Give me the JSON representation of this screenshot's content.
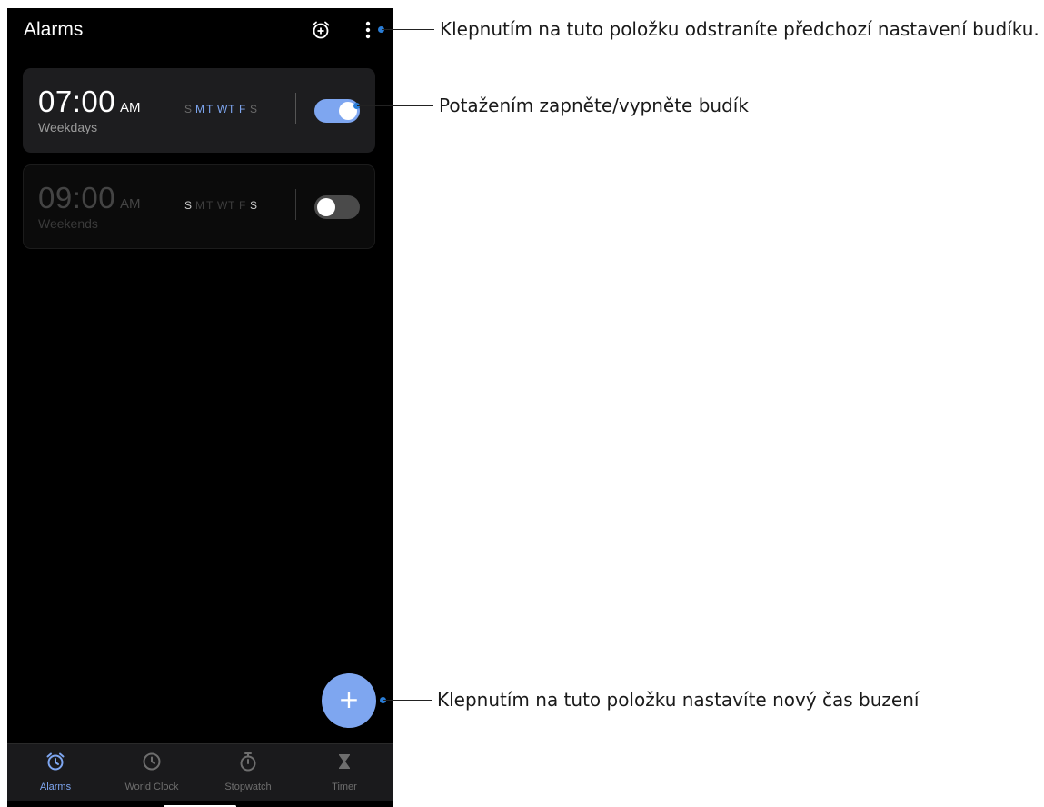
{
  "header": {
    "title": "Alarms",
    "add_alarm_icon": "alarm-add-icon",
    "menu_icon": "more-vertical-icon"
  },
  "alarms": [
    {
      "time": "07:00",
      "ampm": "AM",
      "label": "Weekdays",
      "days": [
        "S",
        "M",
        "T",
        "W",
        "T",
        "F",
        "S"
      ],
      "active_days": [
        false,
        true,
        true,
        true,
        true,
        true,
        false
      ],
      "enabled": true
    },
    {
      "time": "09:00",
      "ampm": "AM",
      "label": "Weekends",
      "days": [
        "S",
        "M",
        "T",
        "W",
        "T",
        "F",
        "S"
      ],
      "active_days": [
        true,
        false,
        false,
        false,
        false,
        false,
        true
      ],
      "enabled": false
    }
  ],
  "fab": {
    "label": "+",
    "icon": "plus-icon"
  },
  "nav": {
    "items": [
      {
        "label": "Alarms",
        "icon": "alarm-clock-icon",
        "active": true
      },
      {
        "label": "World Clock",
        "icon": "clock-icon",
        "active": false
      },
      {
        "label": "Stopwatch",
        "icon": "stopwatch-icon",
        "active": false
      },
      {
        "label": "Timer",
        "icon": "hourglass-icon",
        "active": false
      }
    ]
  },
  "callouts": {
    "menu": "Klepnutím na tuto položku odstraníte předchozí nastavení budíku.",
    "toggle": "Potažením zapněte/vypněte budík",
    "fab": "Klepnutím na tuto položku nastavíte nový čas buzení"
  },
  "colors": {
    "accent": "#7ea6f0",
    "background": "#000000",
    "callout_dot": "#2a7dd6"
  }
}
